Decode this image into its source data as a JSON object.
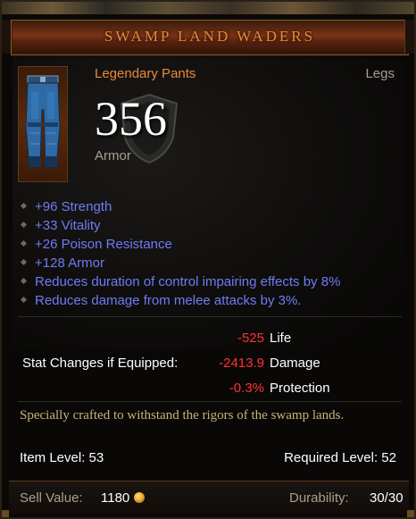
{
  "item": {
    "name": "SWAMP LAND WADERS",
    "rarity_type": "Legendary Pants",
    "slot": "Legs",
    "armor_value": "356",
    "armor_label": "Armor",
    "icon": "pants-icon",
    "affixes": [
      "+96 Strength",
      "+33 Vitality",
      "+26 Poison Resistance",
      "+128 Armor",
      "Reduces duration of control impairing effects by 8%",
      "Reduces damage from melee attacks by 3%."
    ],
    "stat_changes": {
      "label": "Stat Changes if Equipped:",
      "rows": [
        {
          "value": "-525",
          "name": "Life"
        },
        {
          "value": "-2413.9",
          "name": "Damage"
        },
        {
          "value": "-0.3%",
          "name": "Protection"
        }
      ]
    },
    "flavor_text": "Specially crafted to withstand the rigors of the swamp lands.",
    "item_level": "Item Level: 53",
    "required_level": "Required Level: 52",
    "sell_label": "Sell Value:",
    "sell_value": "1180",
    "durability_label": "Durability:",
    "durability_value": "30/30"
  },
  "colors": {
    "legendary": "#e88a3a",
    "magic_affix": "#6f7cf4",
    "stat_negative": "#ff3232",
    "flavor": "#c8b27a",
    "label_gray": "#a89f8f"
  }
}
